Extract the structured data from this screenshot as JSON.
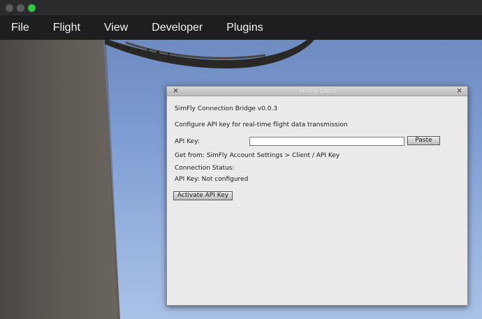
{
  "window": {
    "traffic_lights": [
      "close",
      "minimize",
      "maximize"
    ]
  },
  "menubar": {
    "items": [
      "File",
      "Flight",
      "View",
      "Developer",
      "Plugins"
    ]
  },
  "dialog": {
    "title": "SimFly Client",
    "heading": "SimFly Connection Bridge v0.0.3",
    "description": "Configure API key for real-time flight data transmission",
    "api_key_label": "API Key:",
    "api_key_value": "",
    "paste_label": "Paste",
    "help_text": "Get from: SimFly Account Settings > Client / API Key",
    "status_heading": "Connection Status:",
    "status_text": "API Key: Not configured",
    "activate_label": "Activate API Key"
  }
}
